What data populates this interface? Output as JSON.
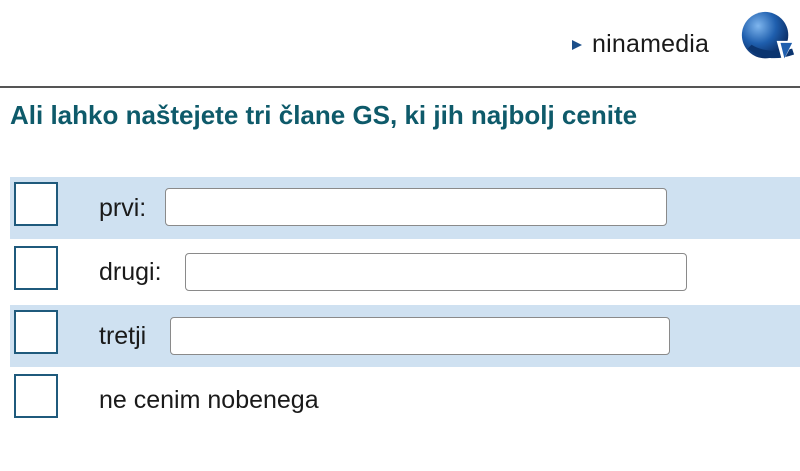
{
  "header": {
    "brand_name": "ninamedia",
    "brand_color": "#1b4f8a"
  },
  "question": {
    "text": "Ali lahko naštejete tri člane GS, ki jih najbolj cenite",
    "color": "#0e5a6a"
  },
  "options": [
    {
      "label": "prvi:",
      "checked": false,
      "input_value": ""
    },
    {
      "label": "drugi:",
      "checked": false,
      "input_value": ""
    },
    {
      "label": "tretji",
      "checked": false,
      "input_value": ""
    },
    {
      "label": "ne cenim nobenega",
      "checked": false
    }
  ],
  "colors": {
    "row_alt_bg": "#cfe1f1",
    "checkbox_border": "#1f5a7c"
  }
}
